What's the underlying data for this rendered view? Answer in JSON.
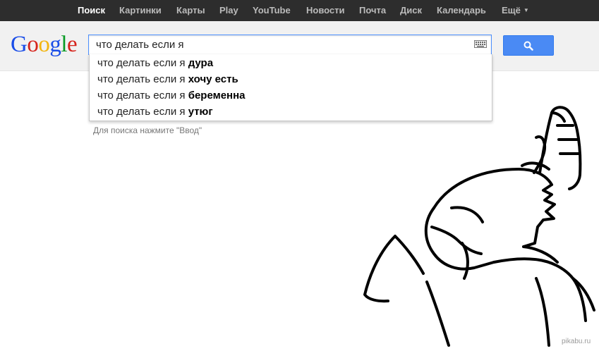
{
  "nav": {
    "items": [
      {
        "label": "Поиск",
        "active": true
      },
      {
        "label": "Картинки"
      },
      {
        "label": "Карты"
      },
      {
        "label": "Play"
      },
      {
        "label": "YouTube"
      },
      {
        "label": "Новости"
      },
      {
        "label": "Почта"
      },
      {
        "label": "Диск"
      },
      {
        "label": "Календарь"
      }
    ],
    "more_label": "Ещё",
    "more_caret": "▼"
  },
  "logo": {
    "letters": [
      "G",
      "o",
      "o",
      "g",
      "l",
      "e"
    ],
    "colors": [
      "#1a4de8",
      "#d6231b",
      "#f2b50f",
      "#1a4de8",
      "#079a24",
      "#d6231b"
    ]
  },
  "search": {
    "value": "что делать если я",
    "keyboard_icon": "keyboard-icon",
    "button_icon": "magnifier-icon"
  },
  "suggestions": [
    {
      "prefix": "что делать если я",
      "completion": "дура"
    },
    {
      "prefix": "что делать если я",
      "completion": "хочу есть"
    },
    {
      "prefix": "что делать если я",
      "completion": "беременна"
    },
    {
      "prefix": "что делать если я",
      "completion": "утюг"
    }
  ],
  "hint": "Для поиска нажмите \"Ввод\"",
  "watermark": "pikabu.ru",
  "colors": {
    "topbar": "#2d2d2d",
    "header": "#f1f1f1",
    "search_button": "#4a8af4",
    "search_border": "#4d90fe"
  }
}
